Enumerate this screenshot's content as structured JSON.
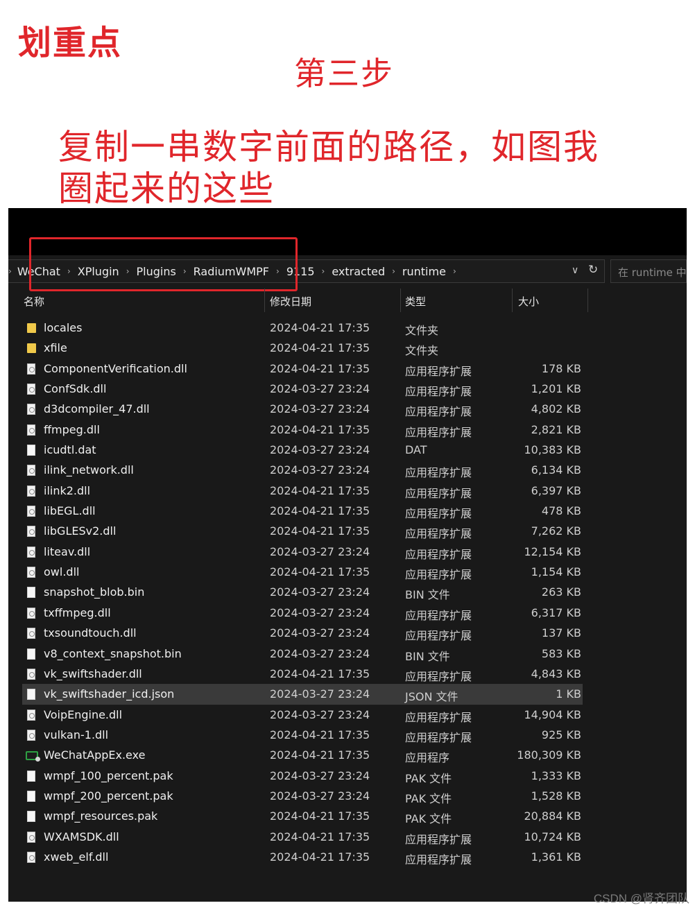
{
  "annotation": {
    "title": "划重点",
    "step": "第三步",
    "instruction_line1": "复制一串数字前面的路径，如图我",
    "instruction_line2": "圈起来的这些",
    "annotation_color": "#e0262b"
  },
  "address_bar": {
    "crumbs": [
      "WeChat",
      "XPlugin",
      "Plugins",
      "RadiumWMPF",
      "9115",
      "extracted",
      "runtime"
    ],
    "dropdown_icon": "chevron-down-icon",
    "refresh_icon": "refresh-icon"
  },
  "search": {
    "placeholder": "在 runtime 中"
  },
  "columns": {
    "name": "名称",
    "date": "修改日期",
    "type": "类型",
    "size": "大小"
  },
  "files": [
    {
      "name": "locales",
      "date": "2024-04-21 17:35",
      "type": "文件夹",
      "size": "",
      "icon": "folder-icon"
    },
    {
      "name": "xfile",
      "date": "2024-04-21 17:35",
      "type": "文件夹",
      "size": "",
      "icon": "folder-icon"
    },
    {
      "name": "ComponentVerification.dll",
      "date": "2024-04-21 17:35",
      "type": "应用程序扩展",
      "size": "178 KB",
      "icon": "dll-file-icon"
    },
    {
      "name": "ConfSdk.dll",
      "date": "2024-03-27 23:24",
      "type": "应用程序扩展",
      "size": "1,201 KB",
      "icon": "dll-file-icon"
    },
    {
      "name": "d3dcompiler_47.dll",
      "date": "2024-03-27 23:24",
      "type": "应用程序扩展",
      "size": "4,802 KB",
      "icon": "dll-file-icon"
    },
    {
      "name": "ffmpeg.dll",
      "date": "2024-04-21 17:35",
      "type": "应用程序扩展",
      "size": "2,821 KB",
      "icon": "dll-file-icon"
    },
    {
      "name": "icudtl.dat",
      "date": "2024-03-27 23:24",
      "type": "DAT",
      "size": "10,383 KB",
      "icon": "file-icon"
    },
    {
      "name": "ilink_network.dll",
      "date": "2024-03-27 23:24",
      "type": "应用程序扩展",
      "size": "6,134 KB",
      "icon": "dll-file-icon"
    },
    {
      "name": "ilink2.dll",
      "date": "2024-04-21 17:35",
      "type": "应用程序扩展",
      "size": "6,397 KB",
      "icon": "dll-file-icon"
    },
    {
      "name": "libEGL.dll",
      "date": "2024-04-21 17:35",
      "type": "应用程序扩展",
      "size": "478 KB",
      "icon": "dll-file-icon"
    },
    {
      "name": "libGLESv2.dll",
      "date": "2024-04-21 17:35",
      "type": "应用程序扩展",
      "size": "7,262 KB",
      "icon": "dll-file-icon"
    },
    {
      "name": "liteav.dll",
      "date": "2024-03-27 23:24",
      "type": "应用程序扩展",
      "size": "12,154 KB",
      "icon": "dll-file-icon"
    },
    {
      "name": "owl.dll",
      "date": "2024-04-21 17:35",
      "type": "应用程序扩展",
      "size": "1,154 KB",
      "icon": "dll-file-icon"
    },
    {
      "name": "snapshot_blob.bin",
      "date": "2024-03-27 23:24",
      "type": "BIN 文件",
      "size": "263 KB",
      "icon": "file-icon"
    },
    {
      "name": "txffmpeg.dll",
      "date": "2024-03-27 23:24",
      "type": "应用程序扩展",
      "size": "6,317 KB",
      "icon": "dll-file-icon"
    },
    {
      "name": "txsoundtouch.dll",
      "date": "2024-03-27 23:24",
      "type": "应用程序扩展",
      "size": "137 KB",
      "icon": "dll-file-icon"
    },
    {
      "name": "v8_context_snapshot.bin",
      "date": "2024-03-27 23:24",
      "type": "BIN 文件",
      "size": "583 KB",
      "icon": "file-icon"
    },
    {
      "name": "vk_swiftshader.dll",
      "date": "2024-04-21 17:35",
      "type": "应用程序扩展",
      "size": "4,843 KB",
      "icon": "dll-file-icon"
    },
    {
      "name": "vk_swiftshader_icd.json",
      "date": "2024-03-27 23:24",
      "type": "JSON 文件",
      "size": "1 KB",
      "icon": "file-icon",
      "selected": true
    },
    {
      "name": "VoipEngine.dll",
      "date": "2024-03-27 23:24",
      "type": "应用程序扩展",
      "size": "14,904 KB",
      "icon": "dll-file-icon"
    },
    {
      "name": "vulkan-1.dll",
      "date": "2024-04-21 17:35",
      "type": "应用程序扩展",
      "size": "925 KB",
      "icon": "dll-file-icon"
    },
    {
      "name": "WeChatAppEx.exe",
      "date": "2024-04-21 17:35",
      "type": "应用程序",
      "size": "180,309 KB",
      "icon": "exe-app-icon"
    },
    {
      "name": "wmpf_100_percent.pak",
      "date": "2024-03-27 23:24",
      "type": "PAK 文件",
      "size": "1,333 KB",
      "icon": "file-icon"
    },
    {
      "name": "wmpf_200_percent.pak",
      "date": "2024-03-27 23:24",
      "type": "PAK 文件",
      "size": "1,528 KB",
      "icon": "file-icon"
    },
    {
      "name": "wmpf_resources.pak",
      "date": "2024-04-21 17:35",
      "type": "PAK 文件",
      "size": "20,884 KB",
      "icon": "file-icon"
    },
    {
      "name": "WXAMSDK.dll",
      "date": "2024-04-21 17:35",
      "type": "应用程序扩展",
      "size": "10,724 KB",
      "icon": "dll-file-icon"
    },
    {
      "name": "xweb_elf.dll",
      "date": "2024-04-21 17:35",
      "type": "应用程序扩展",
      "size": "1,361 KB",
      "icon": "dll-file-icon"
    }
  ],
  "watermark": "CSDN @肾齐团队"
}
